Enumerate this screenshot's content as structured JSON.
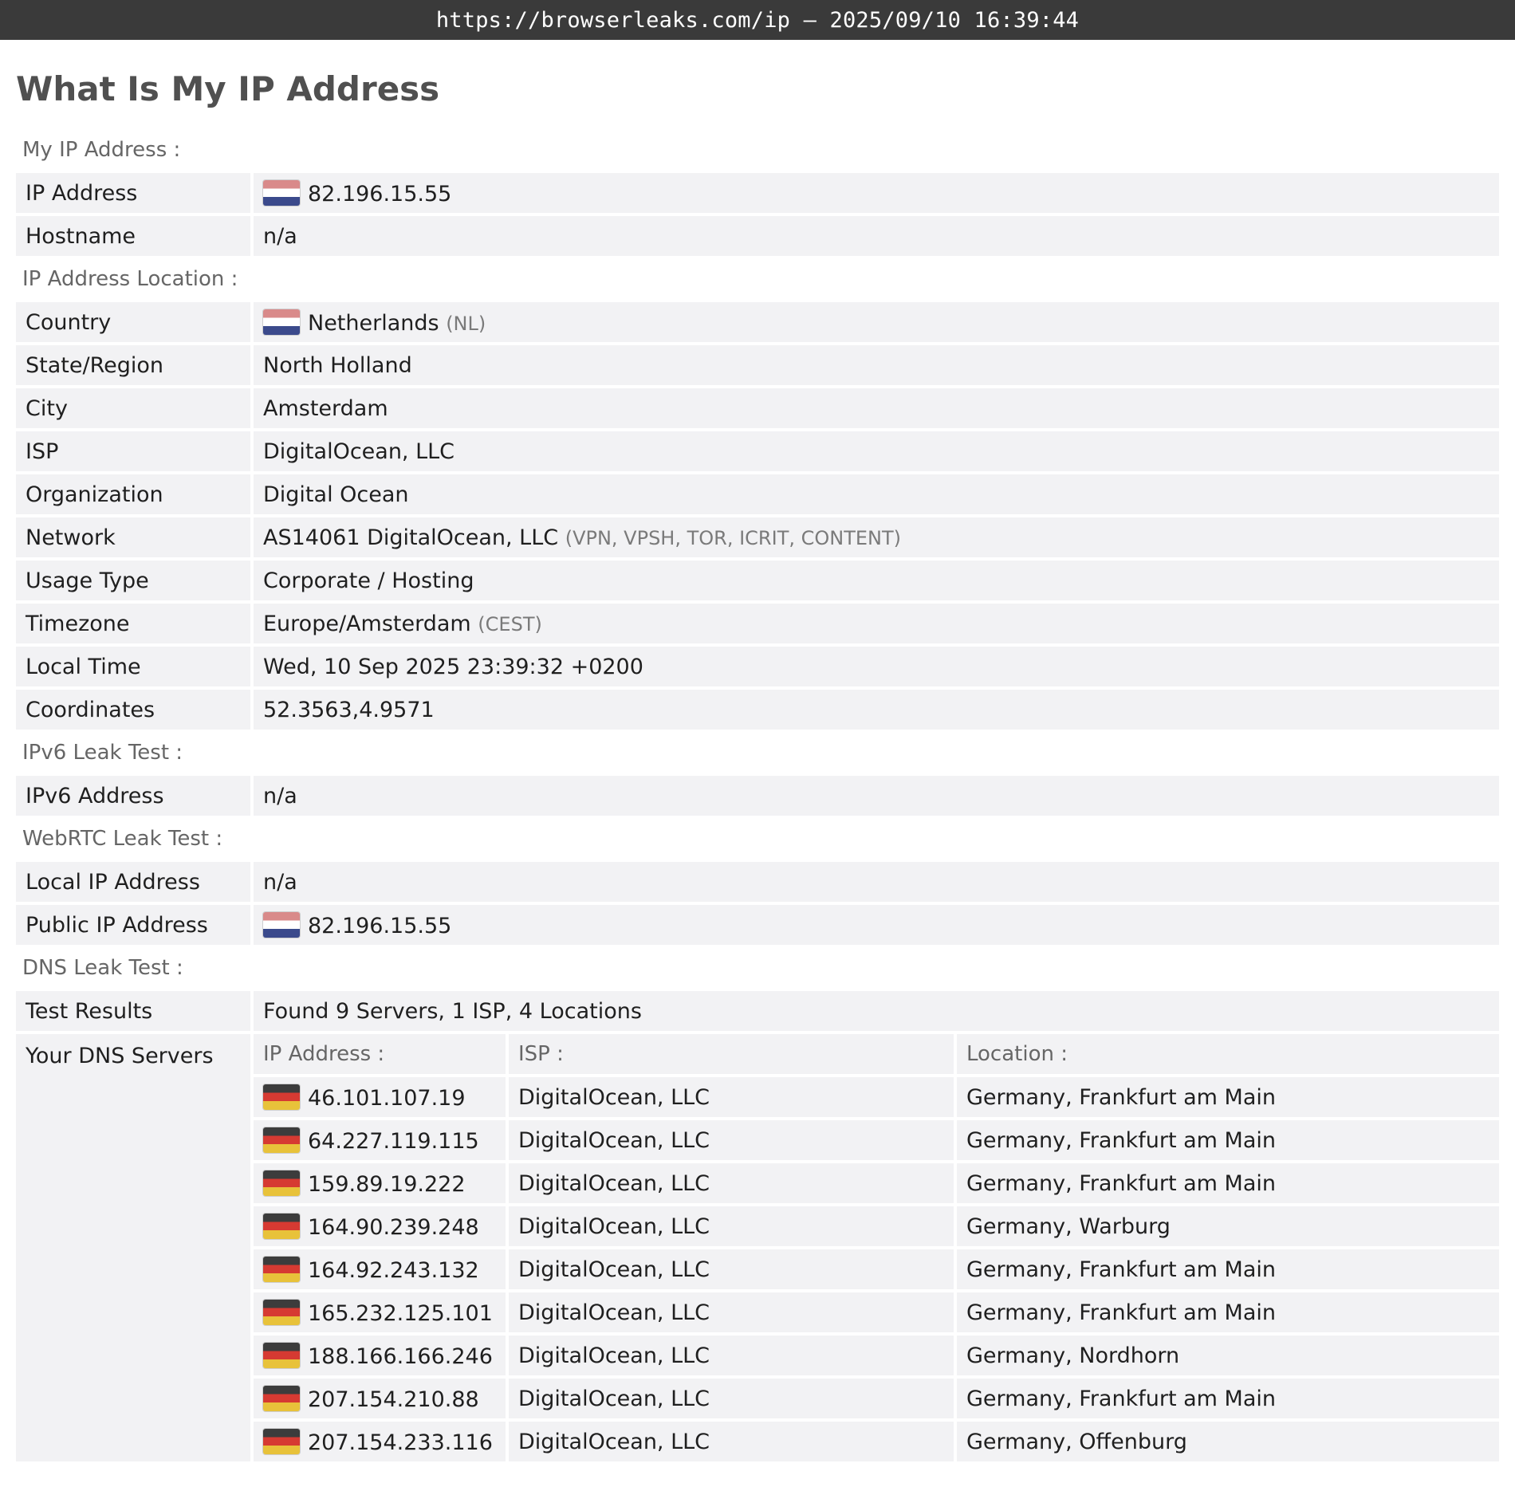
{
  "browser": {
    "url_bar": "https://browserleaks.com/ip – 2025/09/10 16:39:44"
  },
  "page": {
    "title": "What Is My IP Address"
  },
  "sections": {
    "my_ip": {
      "label": "My IP Address :",
      "ip_key": "IP Address",
      "ip_value": "82.196.15.55",
      "ip_flag": "netherlands-flag-icon",
      "host_key": "Hostname",
      "host_value": "n/a"
    },
    "location": {
      "label": "IP Address Location :",
      "country_key": "Country",
      "country_value": "Netherlands",
      "country_code": "(NL)",
      "state_key": "State/Region",
      "state_value": "North Holland",
      "city_key": "City",
      "city_value": "Amsterdam",
      "isp_key": "ISP",
      "isp_value": "DigitalOcean, LLC",
      "org_key": "Organization",
      "org_value": "Digital Ocean",
      "network_key": "Network",
      "network_value": "AS14061 DigitalOcean, LLC",
      "network_tags": "(VPN, VPSH, TOR, ICRIT, CONTENT)",
      "usage_key": "Usage Type",
      "usage_value": "Corporate / Hosting",
      "tz_key": "Timezone",
      "tz_value": "Europe/Amsterdam",
      "tz_abbr": "(CEST)",
      "time_key": "Local Time",
      "time_value": "Wed, 10 Sep 2025 23:39:32 +0200",
      "coord_key": "Coordinates",
      "coord_value": "52.3563,4.9571"
    },
    "ipv6": {
      "label": "IPv6 Leak Test :",
      "addr_key": "IPv6 Address",
      "addr_value": "n/a"
    },
    "webrtc": {
      "label": "WebRTC Leak Test :",
      "local_key": "Local IP Address",
      "local_value": "n/a",
      "public_key": "Public IP Address",
      "public_value": "82.196.15.55"
    },
    "dns": {
      "label": "DNS Leak Test :",
      "results_key": "Test Results",
      "results_value": "Found 9 Servers, 1 ISP, 4 Locations",
      "servers_key": "Your DNS Servers",
      "col_ip": "IP Address :",
      "col_isp": "ISP :",
      "col_location": "Location :",
      "servers": [
        {
          "ip": "46.101.107.19",
          "isp": "DigitalOcean, LLC",
          "location": "Germany, Frankfurt am Main"
        },
        {
          "ip": "64.227.119.115",
          "isp": "DigitalOcean, LLC",
          "location": "Germany, Frankfurt am Main"
        },
        {
          "ip": "159.89.19.222",
          "isp": "DigitalOcean, LLC",
          "location": "Germany, Frankfurt am Main"
        },
        {
          "ip": "164.90.239.248",
          "isp": "DigitalOcean, LLC",
          "location": "Germany, Warburg"
        },
        {
          "ip": "164.92.243.132",
          "isp": "DigitalOcean, LLC",
          "location": "Germany, Frankfurt am Main"
        },
        {
          "ip": "165.232.125.101",
          "isp": "DigitalOcean, LLC",
          "location": "Germany, Frankfurt am Main"
        },
        {
          "ip": "188.166.166.246",
          "isp": "DigitalOcean, LLC",
          "location": "Germany, Nordhorn"
        },
        {
          "ip": "207.154.210.88",
          "isp": "DigitalOcean, LLC",
          "location": "Germany, Frankfurt am Main"
        },
        {
          "ip": "207.154.233.116",
          "isp": "DigitalOcean, LLC",
          "location": "Germany, Offenburg"
        }
      ]
    }
  }
}
